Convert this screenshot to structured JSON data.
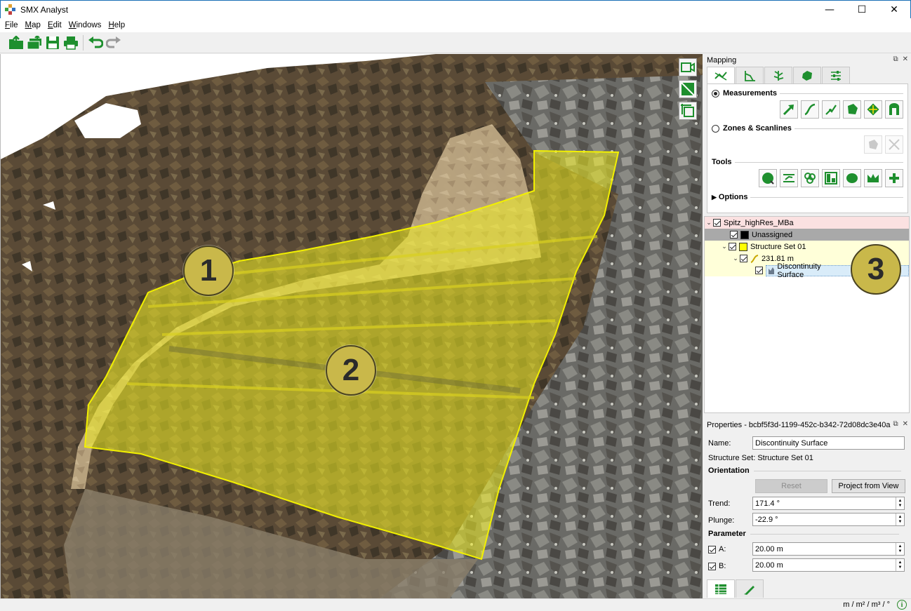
{
  "window": {
    "title": "SMX Analyst",
    "minimize_glyph": "—",
    "maximize_glyph": "☐",
    "close_glyph": "✕"
  },
  "menu": [
    "File",
    "Map",
    "Edit",
    "Windows",
    "Help"
  ],
  "menu_mnemonics": [
    "F",
    "M",
    "E",
    "W",
    "H"
  ],
  "toolbar": {
    "icons": [
      "open-icon",
      "open-multiple-icon",
      "save-icon",
      "print-icon",
      "undo-icon",
      "redo-icon"
    ]
  },
  "viewport": {
    "callouts": [
      "1",
      "2",
      "3"
    ],
    "view_tools": [
      "camera-icon",
      "plane-view-icon",
      "fit-view-icon"
    ],
    "colors": {
      "surface_fill": "#f2f022",
      "surface_stroke": "#f2f000"
    }
  },
  "mapping": {
    "panel_title": "Mapping",
    "tabs": [
      "measure-tab-icon",
      "profile-tab-icon",
      "tree-tab-icon",
      "solid-tab-icon",
      "settings-tab-icon"
    ],
    "measurements_label": "Measurements",
    "zones_label": "Zones & Scanlines",
    "tools_label": "Tools",
    "options_label": "Options"
  },
  "tree": {
    "root": "Spitz_highRes_MBa",
    "unassigned": "Unassigned",
    "structure_set": "Structure Set 01",
    "measurement": "231.81 m",
    "surface": "Discontinuity Surface",
    "colors": {
      "root_bg": "#fbe1e1",
      "unassigned_bg": "#a9a9a9",
      "set_bg": "#ffffd9",
      "set_swatch": "#ffff00",
      "selected_bg": "#d9ecf9"
    }
  },
  "properties": {
    "panel_title": "Properties - bcbf5f3d-1199-452c-b342-72d08dc3e40a",
    "name_label": "Name:",
    "name_value": "Discontinuity Surface",
    "structure_set_label": "Structure Set:",
    "structure_set_value": "Structure Set 01",
    "orientation_label": "Orientation",
    "reset_label": "Reset",
    "project_label": "Project from View",
    "trend_label": "Trend:",
    "trend_value": "171.4 °",
    "plunge_label": "Plunge:",
    "plunge_value": "-22.9 °",
    "parameter_label": "Parameter",
    "a_label": "A:",
    "a_value": "20.00 m",
    "b_label": "B:",
    "b_value": "20.00 m",
    "bottom_tabs": [
      "table-icon",
      "edit-icon"
    ]
  },
  "status": {
    "units": "m / m² / m³ / °",
    "info_glyph": "i"
  }
}
